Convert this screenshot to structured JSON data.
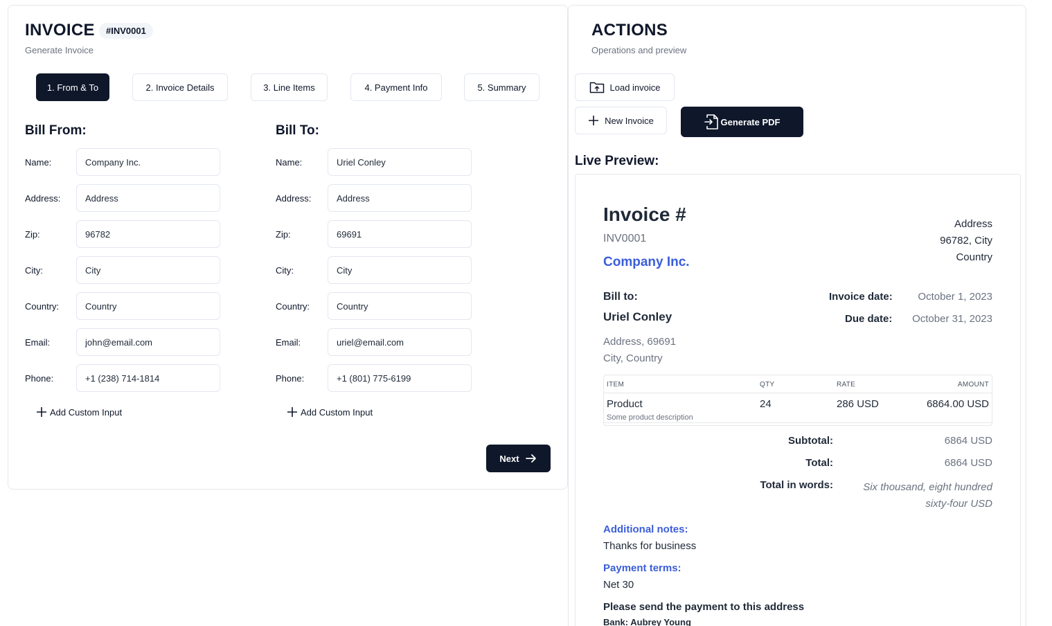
{
  "left": {
    "title": "INVOICE",
    "badge": "#INV0001",
    "subtitle": "Generate Invoice",
    "tabs": [
      {
        "label": "1. From & To",
        "active": true
      },
      {
        "label": "2. Invoice Details"
      },
      {
        "label": "3. Line Items"
      },
      {
        "label": "4. Payment Info"
      },
      {
        "label": "5. Summary"
      }
    ],
    "bill_from": {
      "heading": "Bill From:",
      "fields": [
        {
          "label": "Name:",
          "value": "Company Inc."
        },
        {
          "label": "Address:",
          "value": "Address"
        },
        {
          "label": "Zip:",
          "value": "96782"
        },
        {
          "label": "City:",
          "value": "City"
        },
        {
          "label": "Country:",
          "value": "Country"
        },
        {
          "label": "Email:",
          "value": "john@email.com"
        },
        {
          "label": "Phone:",
          "value": "+1 (238) 714-1814"
        }
      ],
      "add_custom": "Add Custom Input"
    },
    "bill_to": {
      "heading": "Bill To:",
      "fields": [
        {
          "label": "Name:",
          "value": "Uriel Conley"
        },
        {
          "label": "Address:",
          "value": "Address"
        },
        {
          "label": "Zip:",
          "value": "69691"
        },
        {
          "label": "City:",
          "value": "City"
        },
        {
          "label": "Country:",
          "value": "Country"
        },
        {
          "label": "Email:",
          "value": "uriel@email.com"
        },
        {
          "label": "Phone:",
          "value": "+1 (801) 775-6199"
        }
      ],
      "add_custom": "Add Custom Input"
    },
    "next_label": "Next"
  },
  "actions": {
    "title": "ACTIONS",
    "subtitle": "Operations and preview",
    "load_label": "Load invoice",
    "new_label": "New Invoice",
    "generate_label": "Generate PDF",
    "live_preview_label": "Live Preview:"
  },
  "preview": {
    "title": "Invoice #",
    "number": "INV0001",
    "company": "Company Inc.",
    "sender_address": [
      "Address",
      "96782, City",
      "Country"
    ],
    "bill_to_label": "Bill to:",
    "client_name": "Uriel Conley",
    "client_address": [
      "Address, 69691",
      "City, Country"
    ],
    "invoice_date_label": "Invoice date:",
    "invoice_date": "October 1, 2023",
    "due_date_label": "Due date:",
    "due_date": "October 31, 2023",
    "table": {
      "headers": [
        "ITEM",
        "QTY",
        "RATE",
        "AMOUNT"
      ],
      "rows": [
        {
          "item": "Product",
          "description": "Some product description",
          "qty": "24",
          "rate": "286 USD",
          "amount": "6864.00 USD"
        }
      ]
    },
    "subtotal_label": "Subtotal:",
    "subtotal": "6864 USD",
    "total_label": "Total:",
    "total": "6864 USD",
    "words_label": "Total in words:",
    "words_line1": "Six thousand, eight hundred",
    "words_line2": "sixty-four USD",
    "notes_label": "Additional notes:",
    "notes": "Thanks for business",
    "terms_label": "Payment terms:",
    "terms": "Net 30",
    "payment_heading": "Please send the payment to this address",
    "bank_line": "Bank: Aubrey Young"
  },
  "colors": {
    "dark": "#0f172a",
    "accent_blue": "#3b5ed8",
    "border": "#e2e8f0"
  }
}
